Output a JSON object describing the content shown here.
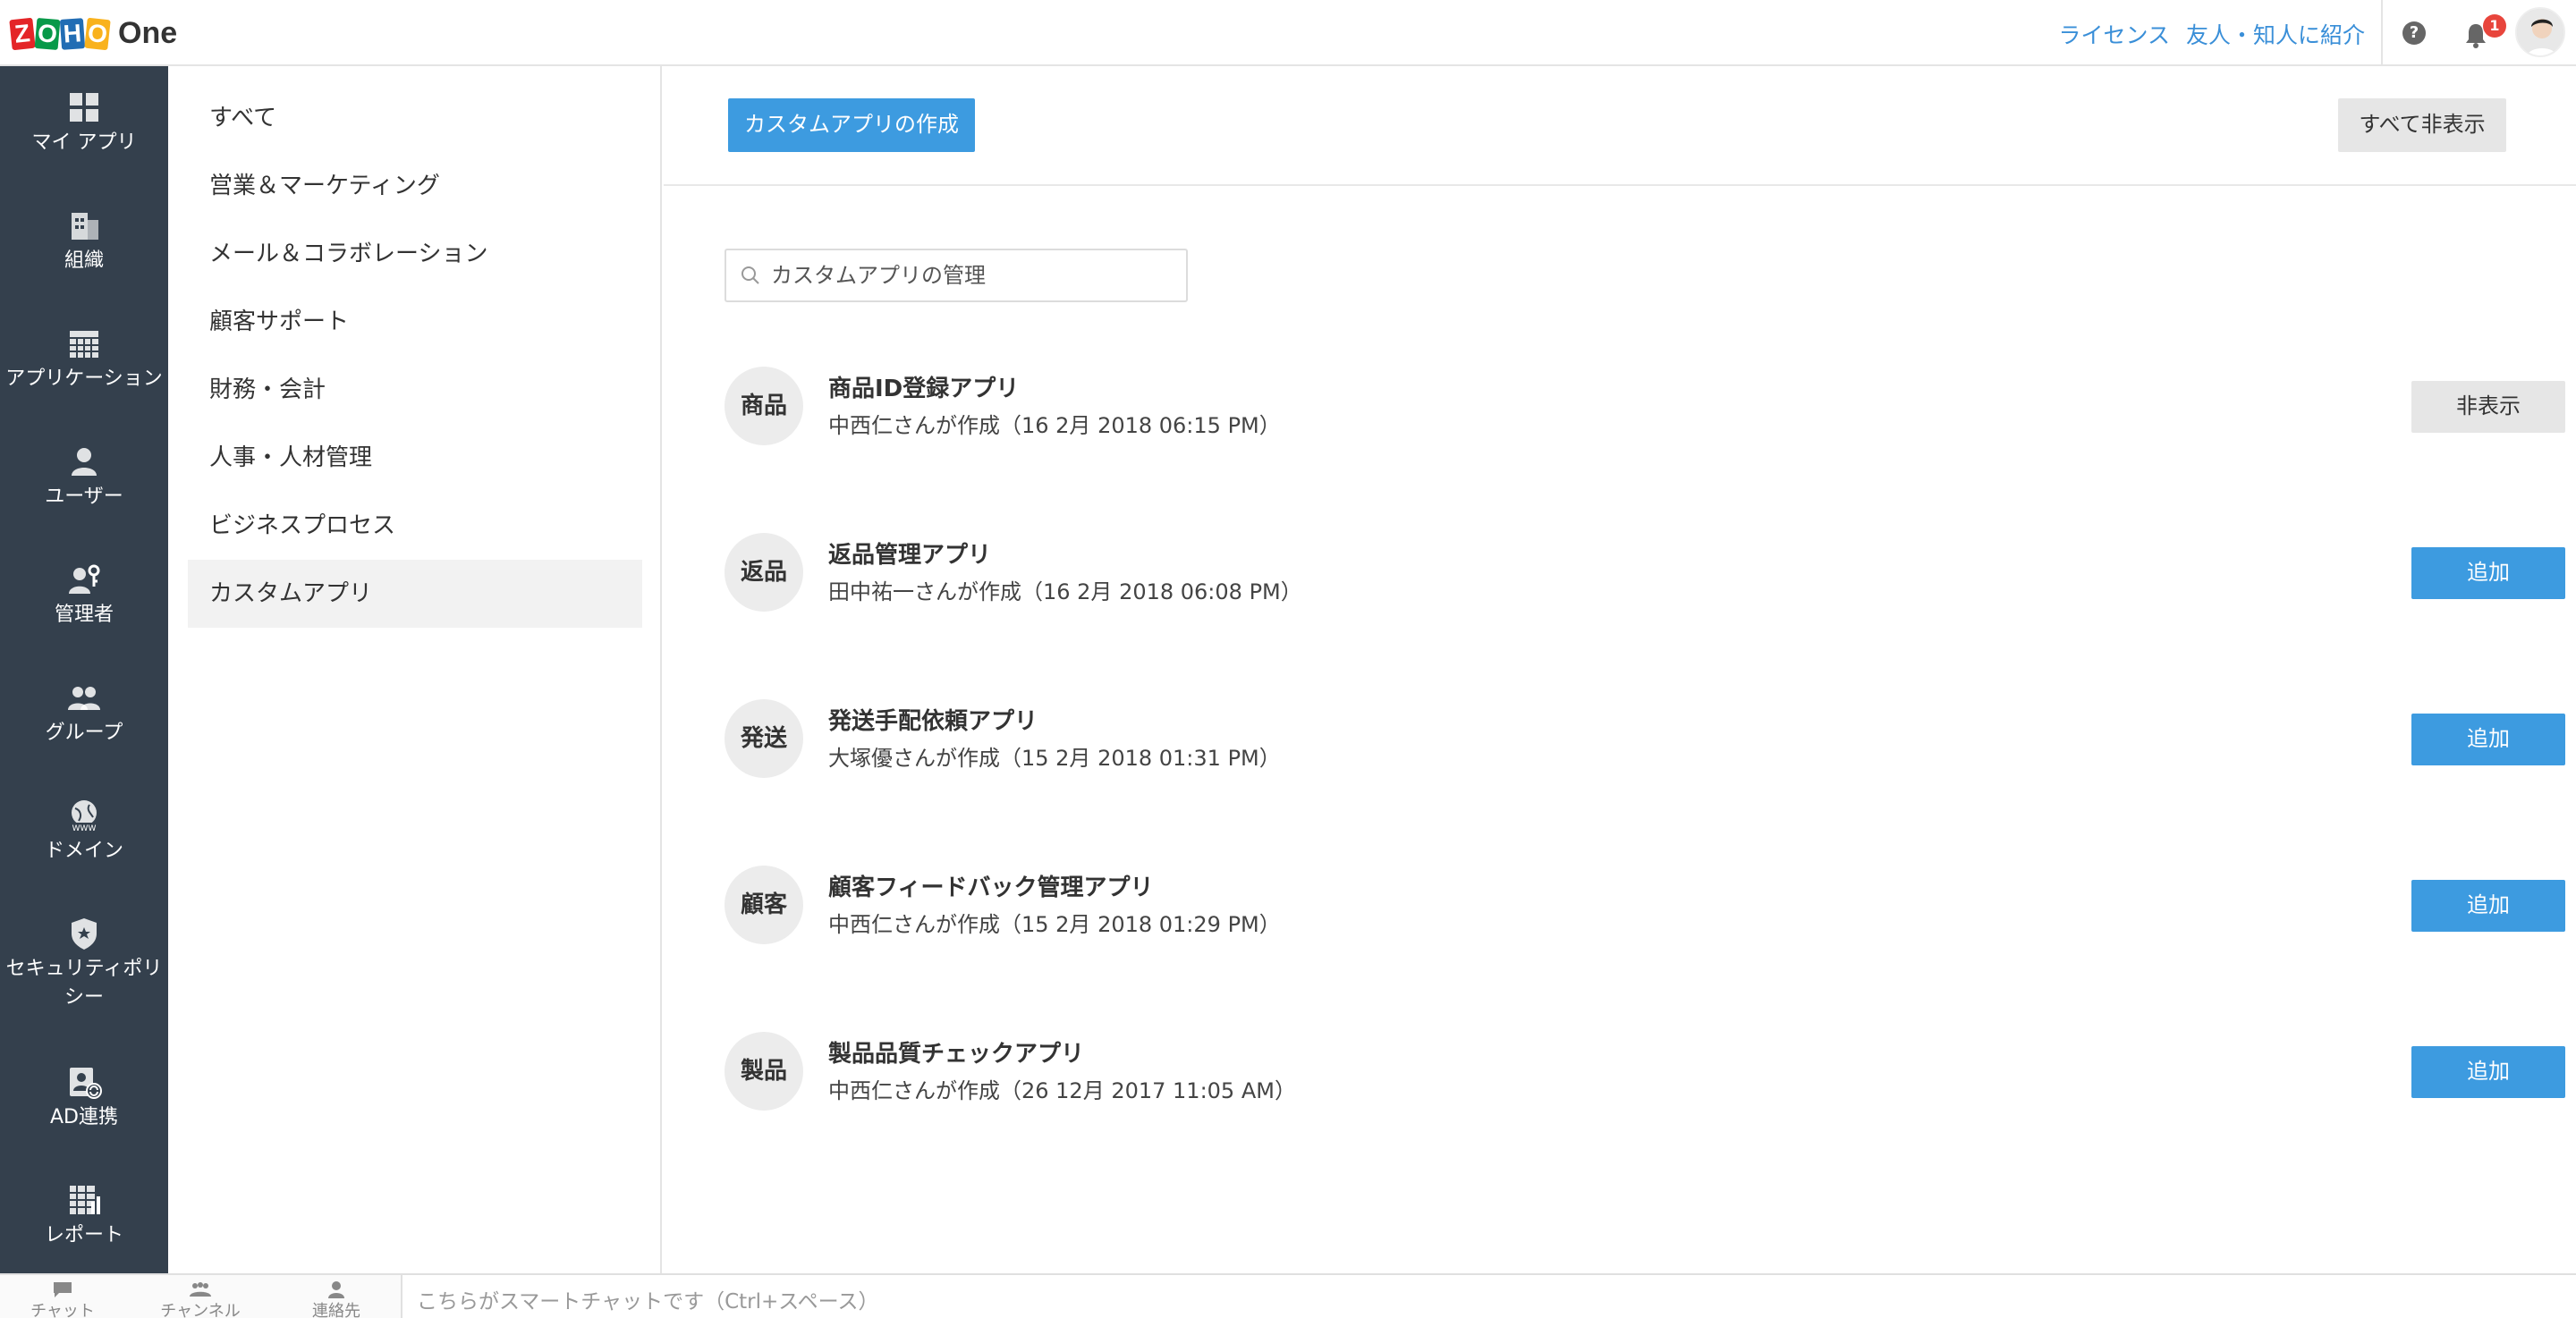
{
  "topbar": {
    "logo_letters": [
      "Z",
      "O",
      "H",
      "O"
    ],
    "logo_colors": [
      "#e42527",
      "#089949",
      "#226db4",
      "#f9b21d"
    ],
    "product_name": "One",
    "links": [
      "ライセンス",
      "友人・知人に紹介"
    ],
    "help_icon": "?",
    "notification_count": "1"
  },
  "leftnav": {
    "items": [
      {
        "label": "マイ アプリ",
        "icon": "grid-icon"
      },
      {
        "label": "組織",
        "icon": "building-icon"
      },
      {
        "label": "アプリケーション",
        "icon": "table-icon"
      },
      {
        "label": "ユーザー",
        "icon": "user-icon"
      },
      {
        "label": "管理者",
        "icon": "admin-key-icon"
      },
      {
        "label": "グループ",
        "icon": "group-icon"
      },
      {
        "label": "ドメイン",
        "icon": "globe-www-icon"
      },
      {
        "label": "セキュリティポリシー",
        "icon": "shield-star-icon"
      },
      {
        "label": "AD連携",
        "icon": "ad-sync-icon"
      },
      {
        "label": "レポート",
        "icon": "report-icon"
      }
    ]
  },
  "categories": {
    "items": [
      "すべて",
      "営業＆マーケティング",
      "メール＆コラボレーション",
      "顧客サポート",
      "財務・会計",
      "人事・人材管理",
      "ビジネスプロセス",
      "カスタムアプリ"
    ],
    "active": "カスタムアプリ"
  },
  "main": {
    "create_button": "カスタムアプリの作成",
    "hide_all_button": "すべて非表示",
    "search_placeholder": "カスタムアプリの管理",
    "apps": [
      {
        "badge": "商品",
        "name": "商品ID登録アプリ",
        "meta": "中西仁さんが作成（16 2月 2018 06:15 PM）",
        "action": "非表示",
        "action_style": "grey"
      },
      {
        "badge": "返品",
        "name": "返品管理アプリ",
        "meta": "田中祐一さんが作成（16 2月 2018 06:08 PM）",
        "action": "追加",
        "action_style": "primary"
      },
      {
        "badge": "発送",
        "name": "発送手配依頼アプリ",
        "meta": "大塚優さんが作成（15 2月 2018 01:31 PM）",
        "action": "追加",
        "action_style": "primary"
      },
      {
        "badge": "顧客",
        "name": "顧客フィードバック管理アプリ",
        "meta": "中西仁さんが作成（15 2月 2018 01:29 PM）",
        "action": "追加",
        "action_style": "primary"
      },
      {
        "badge": "製品",
        "name": "製品品質チェックアプリ",
        "meta": "中西仁さんが作成（26 12月 2017 11:05 AM）",
        "action": "追加",
        "action_style": "primary"
      }
    ]
  },
  "chatbar": {
    "tabs": [
      "チャット",
      "チャンネル",
      "連絡先"
    ],
    "placeholder": "こちらがスマートチャットです（Ctrl+スペース）"
  },
  "colors": {
    "accent": "#3d9be0",
    "nav_bg": "#34404d",
    "link": "#3a8fd8",
    "badge_red": "#e8453c"
  }
}
